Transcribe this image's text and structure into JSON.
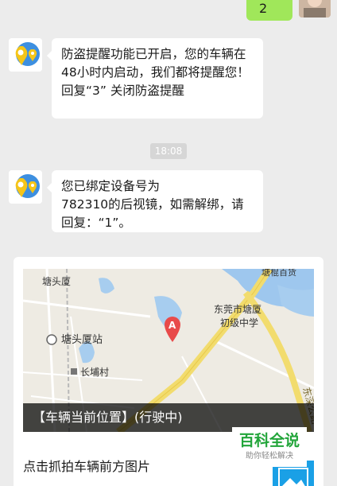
{
  "top_message": {
    "text": "2"
  },
  "messages": [
    {
      "lines": [
        "防盗提醒功能已开启，您的车辆在",
        "48小时内启动，我们都将提醒您！",
        "回复“3” 关闭防盗提醒"
      ]
    },
    {
      "lines": [
        "您已绑定设备号为",
        "782310的后视镜，如需解绑，请",
        "回复：“1”。"
      ]
    }
  ],
  "timestamp": "18:08",
  "card": {
    "map_caption": "【车辆当前位置】(行驶中)",
    "map_labels": {
      "place1": "塘头厦",
      "station": "塘头厦站",
      "village": "长埔村",
      "school1": "东莞市塘厦",
      "school2": "初级中学",
      "top_right": "塘棍百货",
      "road": "东深公路",
      "marker": "A"
    },
    "link_text": "点击抓拍车辆前方图片"
  },
  "watermark": {
    "main": "百科全说",
    "sub": "助你轻松解决"
  },
  "colors": {
    "background": "#ececec",
    "self_bubble": "#a0e75a",
    "watermark_green": "#22a53a"
  }
}
